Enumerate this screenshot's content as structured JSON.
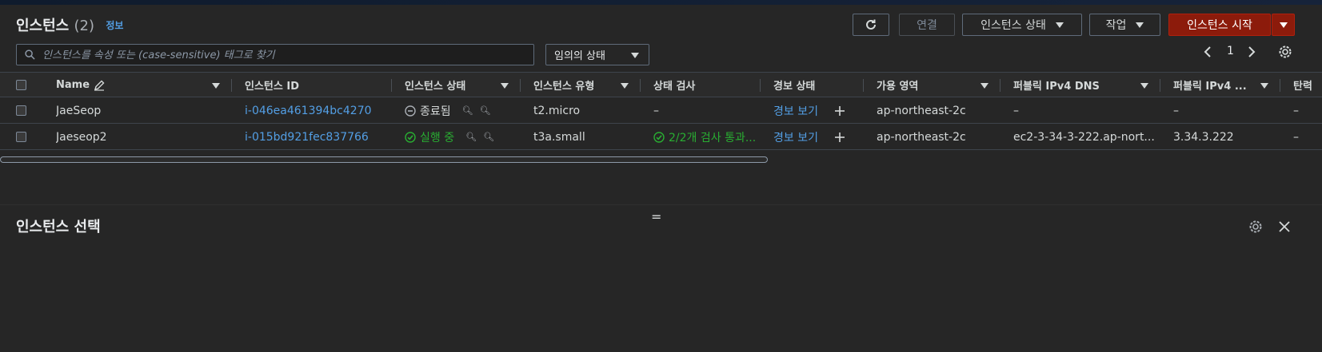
{
  "header": {
    "title": "인스턴스",
    "count": "(2)",
    "info_link": "정보"
  },
  "toolbar": {
    "connect_label": "연결",
    "instance_state_label": "인스턴스 상태",
    "actions_label": "작업",
    "launch_label": "인스턴스 시작"
  },
  "search": {
    "placeholder": "인스턴스를 속성 또는 (case-sensitive) 태그로 찾기",
    "state_filter": "임의의 상태"
  },
  "pagination": {
    "current_page": "1"
  },
  "table": {
    "columns": [
      "Name",
      "인스턴스 ID",
      "인스턴스 상태",
      "인스턴스 유형",
      "상태 검사",
      "경보 상태",
      "가용 영역",
      "퍼블릭 IPv4 DNS",
      "퍼블릭 IPv4 ...",
      "탄력"
    ],
    "rows": [
      {
        "name": "JaeSeop",
        "instance_id": "i-046ea461394bc4270",
        "state": "종료됨",
        "state_kind": "terminated",
        "type": "t2.micro",
        "status_check": "–",
        "status_ok": false,
        "alarm": "경보 보기",
        "az": "ap-northeast-2c",
        "public_dns": "–",
        "public_ip": "–",
        "elastic": "–"
      },
      {
        "name": "Jaeseop2",
        "instance_id": "i-015bd921fec837766",
        "state": "실행 중",
        "state_kind": "running",
        "type": "t3a.small",
        "status_check": "2/2개 검사 통과...",
        "status_ok": true,
        "alarm": "경보 보기",
        "az": "ap-northeast-2c",
        "public_dns": "ec2-3-34-3-222.ap-nort...",
        "public_ip": "3.34.3.222",
        "elastic": "–"
      }
    ]
  },
  "drag_handle": "=",
  "details": {
    "title": "인스턴스 선택"
  },
  "colors": {
    "background": "#232323",
    "link": "#539fe5",
    "running_green": "#29ad32",
    "primary_button": "#8c1b0b"
  }
}
